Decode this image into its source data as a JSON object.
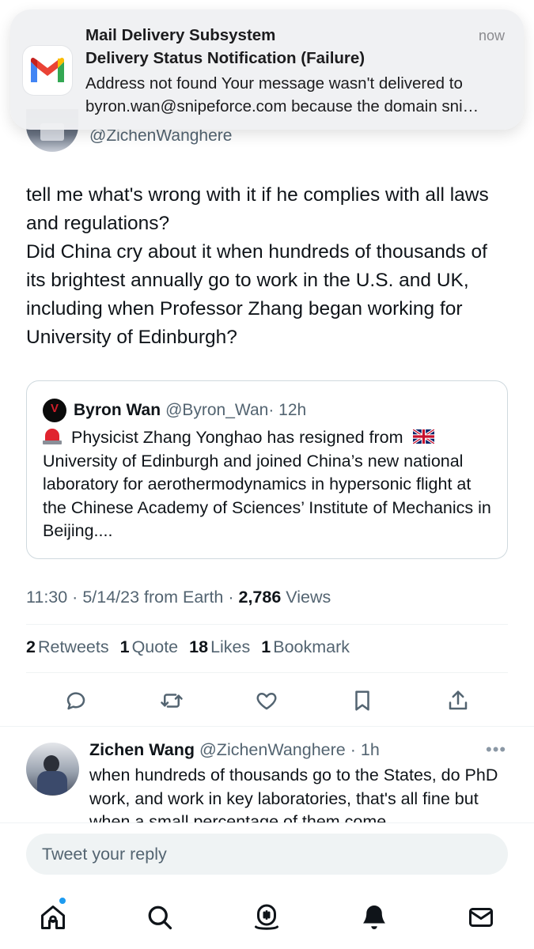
{
  "notification": {
    "app": "Mail Delivery Subsystem",
    "time": "now",
    "title": "Delivery Status Notification (Failure)",
    "body_line1": "Address not found Your message wasn't delivered to",
    "body_line2": "byron.wan@snipeforce.com because the domain sni…",
    "icon": "gmail-icon"
  },
  "tweet": {
    "handle": "@ZichenWanghere",
    "text_line1": "tell me what's wrong with it if he complies with all laws and regulations?",
    "text_line2": "Did China cry about it when hundreds of thousands of its brightest annually go to work in the U.S. and UK, including when Professor Zhang began working for University of Edinburgh?",
    "meta_prefix": "11:30 · 5/14/23 from Earth · ",
    "views_count": "2,786",
    "views_label": " Views"
  },
  "quote": {
    "name": "Byron Wan",
    "handle": "@Byron_Wan",
    "time": " · 12h",
    "text_before_flag": "Physicist Zhang Yonghao has resigned from",
    "text_after_flag": "University of Edinburgh and joined China’s new national laboratory for aerothermodynamics in hypersonic flight at the Chinese Academy of Sciences’ Institute of Mechanics in Beijing...."
  },
  "stats": {
    "retweets_count": "2",
    "retweets_label": "Retweets",
    "quotes_count": "1",
    "quotes_label": "Quote",
    "likes_count": "18",
    "likes_label": "Likes",
    "bookmarks_count": "1",
    "bookmarks_label": "Bookmark"
  },
  "reply": {
    "name": "Zichen Wang",
    "handle": "@ZichenWanghere",
    "time": " · 1h",
    "more": "•••",
    "text": "when hundreds of thousands go to the States, do PhD work, and work in key laboratories, that's all fine but when a small percentage of them come"
  },
  "compose": {
    "placeholder": "Tweet your reply"
  },
  "colors": {
    "accent": "#1d9bf0",
    "text": "#0f1419",
    "secondary": "#536471"
  }
}
